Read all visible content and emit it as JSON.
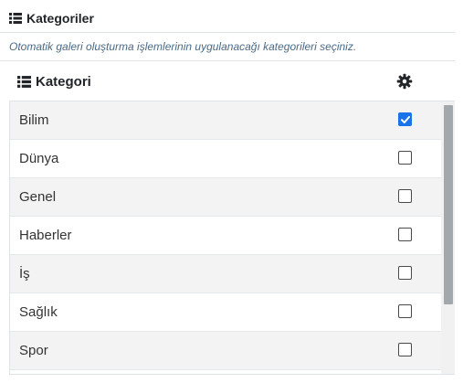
{
  "panel": {
    "title": "Kategoriler",
    "description": "Otomatik galeri oluşturma işlemlerinin uygulanacağı kategorileri seçiniz."
  },
  "table": {
    "column_title": "Kategori",
    "settings_icon": "gear-icon",
    "rows": [
      {
        "label": "Bilim",
        "checked": true
      },
      {
        "label": "Dünya",
        "checked": false
      },
      {
        "label": "Genel",
        "checked": false
      },
      {
        "label": "Haberler",
        "checked": false
      },
      {
        "label": "İş",
        "checked": false
      },
      {
        "label": "Sağlık",
        "checked": false
      },
      {
        "label": "Spor",
        "checked": false
      }
    ]
  },
  "colors": {
    "accent": "#1a73e8",
    "description_text": "#4b6a86",
    "row_stripe": "#f3f3f3"
  }
}
